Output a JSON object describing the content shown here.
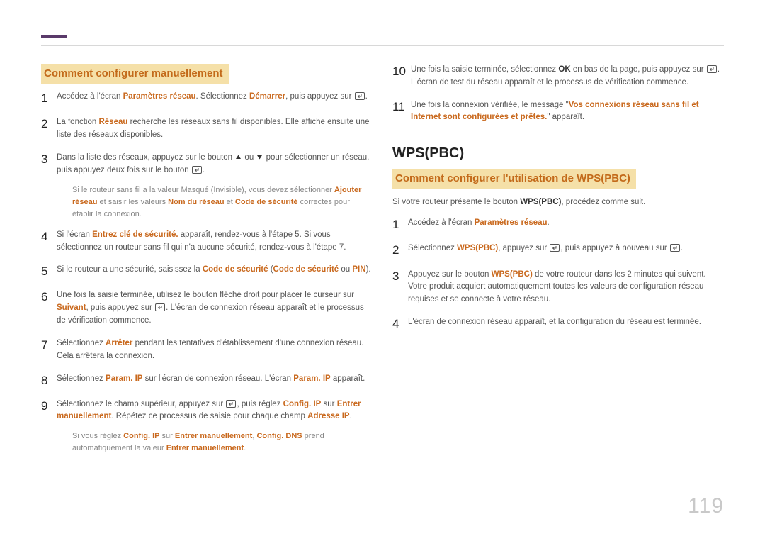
{
  "page_number": "119",
  "left": {
    "title": "Comment configurer manuellement",
    "steps": [
      {
        "n": "1",
        "segs": [
          {
            "t": "Accédez à l'écran "
          },
          {
            "t": "Paramètres réseau",
            "c": "hl"
          },
          {
            "t": ". Sélectionnez "
          },
          {
            "t": "Démarrer",
            "c": "hl"
          },
          {
            "t": ", puis appuyez sur "
          },
          {
            "icon": "enter"
          },
          {
            "t": "."
          }
        ]
      },
      {
        "n": "2",
        "segs": [
          {
            "t": "La fonction "
          },
          {
            "t": "Réseau",
            "c": "hl"
          },
          {
            "t": " recherche les réseaux sans fil disponibles. Elle affiche ensuite une liste des réseaux disponibles."
          }
        ]
      },
      {
        "n": "3",
        "segs": [
          {
            "t": "Dans la liste des réseaux, appuyez sur le bouton "
          },
          {
            "icon": "up"
          },
          {
            "t": " ou "
          },
          {
            "icon": "down"
          },
          {
            "t": " pour sélectionner un réseau, puis appuyez deux fois sur le bouton "
          },
          {
            "icon": "enter"
          },
          {
            "t": "."
          }
        ],
        "note": [
          {
            "t": "Si le routeur sans fil a la valeur Masqué (Invisible), vous devez sélectionner "
          },
          {
            "t": "Ajouter réseau",
            "c": "hl"
          },
          {
            "t": " et saisir les valeurs "
          },
          {
            "t": "Nom du réseau",
            "c": "hl"
          },
          {
            "t": " et "
          },
          {
            "t": "Code de sécurité",
            "c": "hl"
          },
          {
            "t": " correctes pour établir la connexion."
          }
        ]
      },
      {
        "n": "4",
        "segs": [
          {
            "t": "Si l'écran "
          },
          {
            "t": "Entrez clé de sécurité.",
            "c": "hl"
          },
          {
            "t": " apparaît, rendez-vous à l'étape 5. Si vous sélectionnez un routeur sans fil qui n'a aucune sécurité, rendez-vous à l'étape 7."
          }
        ]
      },
      {
        "n": "5",
        "segs": [
          {
            "t": "Si le routeur a une sécurité, saisissez la "
          },
          {
            "t": "Code de sécurité",
            "c": "hl"
          },
          {
            "t": " ("
          },
          {
            "t": "Code de sécurité",
            "c": "hl"
          },
          {
            "t": " ou "
          },
          {
            "t": "PIN",
            "c": "hl"
          },
          {
            "t": ")."
          }
        ]
      },
      {
        "n": "6",
        "segs": [
          {
            "t": "Une fois la saisie terminée, utilisez le bouton fléché droit pour placer le curseur sur "
          },
          {
            "t": "Suivant",
            "c": "hl"
          },
          {
            "t": ", puis appuyez sur "
          },
          {
            "icon": "enter"
          },
          {
            "t": ". L'écran de connexion réseau apparaît et le processus de vérification commence."
          }
        ]
      },
      {
        "n": "7",
        "segs": [
          {
            "t": "Sélectionnez "
          },
          {
            "t": "Arrêter",
            "c": "hl"
          },
          {
            "t": " pendant les tentatives d'établissement d'une connexion réseau. Cela arrêtera la connexion."
          }
        ]
      },
      {
        "n": "8",
        "segs": [
          {
            "t": "Sélectionnez "
          },
          {
            "t": "Param. IP",
            "c": "hl"
          },
          {
            "t": " sur l'écran de connexion réseau. L'écran "
          },
          {
            "t": "Param. IP",
            "c": "hl"
          },
          {
            "t": " apparaît."
          }
        ]
      },
      {
        "n": "9",
        "segs": [
          {
            "t": "Sélectionnez le champ supérieur, appuyez sur "
          },
          {
            "icon": "enter"
          },
          {
            "t": ", puis réglez "
          },
          {
            "t": "Config. IP",
            "c": "hl"
          },
          {
            "t": " sur "
          },
          {
            "t": "Entrer manuellement",
            "c": "hl"
          },
          {
            "t": ". Répétez ce processus de saisie pour chaque champ "
          },
          {
            "t": "Adresse IP",
            "c": "hl"
          },
          {
            "t": "."
          }
        ],
        "note": [
          {
            "t": "Si vous réglez "
          },
          {
            "t": "Config. IP",
            "c": "hl"
          },
          {
            "t": " sur "
          },
          {
            "t": "Entrer manuellement",
            "c": "hl"
          },
          {
            "t": ", "
          },
          {
            "t": "Config. DNS",
            "c": "hl"
          },
          {
            "t": " prend automatiquement la valeur "
          },
          {
            "t": "Entrer manuellement",
            "c": "hl"
          },
          {
            "t": "."
          }
        ]
      }
    ]
  },
  "right": {
    "cont": [
      {
        "n": "10",
        "segs": [
          {
            "t": "Une fois la saisie terminée, sélectionnez "
          },
          {
            "t": "OK",
            "c": "bold"
          },
          {
            "t": " en bas de la page, puis appuyez sur "
          },
          {
            "icon": "enter"
          },
          {
            "t": ". L'écran de test du réseau apparaît et le processus de vérification commence."
          }
        ]
      },
      {
        "n": "11",
        "segs": [
          {
            "t": "Une fois la connexion vérifiée, le message \""
          },
          {
            "t": "Vos connexions réseau sans fil et Internet sont configurées et prêtes.",
            "c": "hl"
          },
          {
            "t": "\" apparaît."
          }
        ]
      }
    ],
    "h2": "WPS(PBC)",
    "title": "Comment configurer l'utilisation de WPS(PBC)",
    "intro_segs": [
      {
        "t": "Si votre routeur présente le bouton "
      },
      {
        "t": "WPS(PBC)",
        "c": "bold"
      },
      {
        "t": ", procédez comme suit."
      }
    ],
    "steps": [
      {
        "n": "1",
        "segs": [
          {
            "t": "Accédez à l'écran "
          },
          {
            "t": "Paramètres réseau",
            "c": "hl"
          },
          {
            "t": "."
          }
        ]
      },
      {
        "n": "2",
        "segs": [
          {
            "t": "Sélectionnez "
          },
          {
            "t": "WPS(PBC)",
            "c": "hl"
          },
          {
            "t": ", appuyez sur "
          },
          {
            "icon": "enter"
          },
          {
            "t": ", puis appuyez à nouveau sur "
          },
          {
            "icon": "enter"
          },
          {
            "t": "."
          }
        ]
      },
      {
        "n": "3",
        "segs": [
          {
            "t": "Appuyez sur le bouton "
          },
          {
            "t": "WPS(PBC)",
            "c": "hl"
          },
          {
            "t": " de votre routeur dans les 2 minutes qui suivent. Votre produit acquiert automatiquement toutes les valeurs de configuration réseau requises et se connecte à votre réseau."
          }
        ]
      },
      {
        "n": "4",
        "segs": [
          {
            "t": "L'écran de connexion réseau apparaît, et la configuration du réseau est terminée."
          }
        ]
      }
    ]
  }
}
